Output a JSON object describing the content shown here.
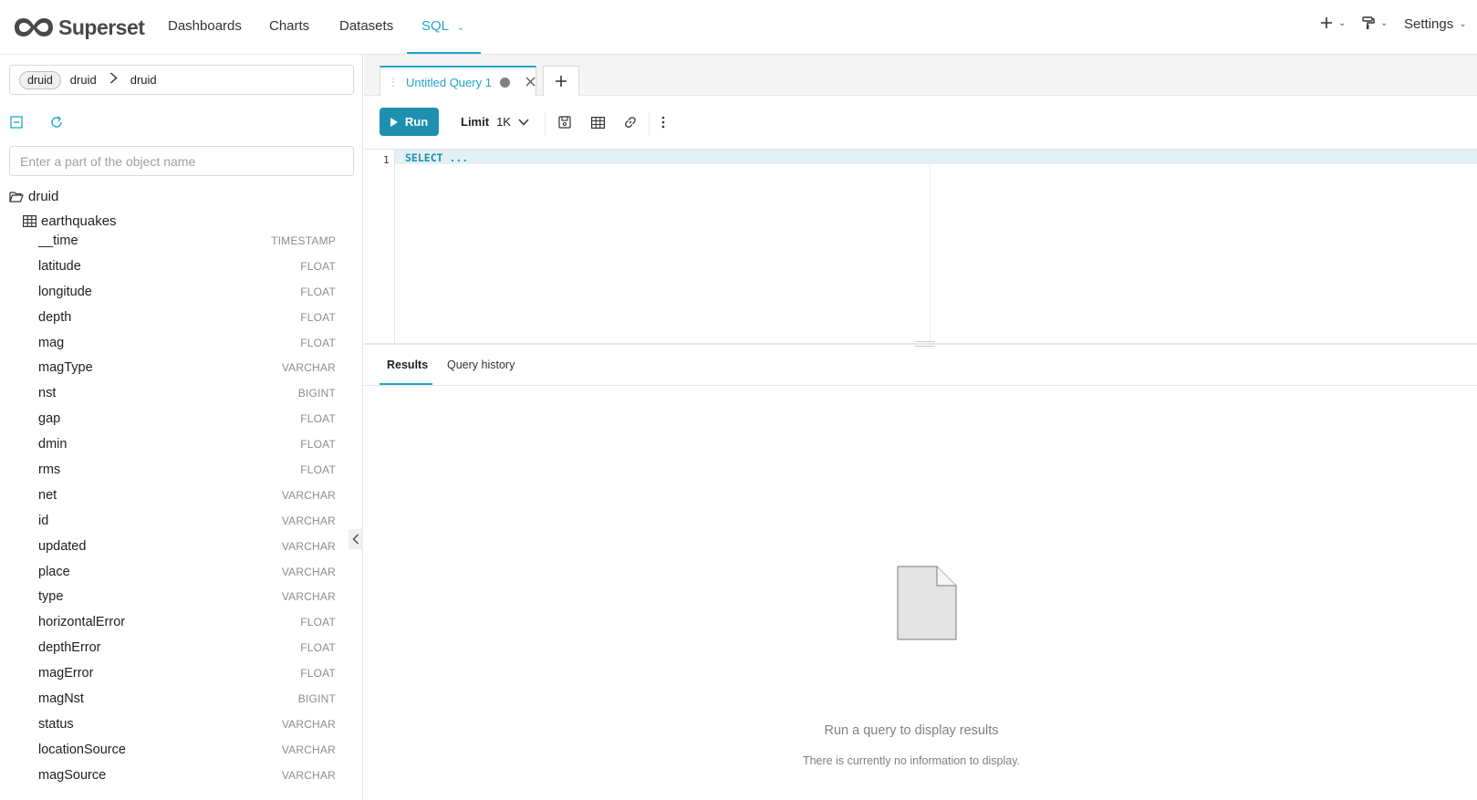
{
  "brand": {
    "name": "Superset"
  },
  "nav": {
    "items": [
      {
        "label": "Dashboards"
      },
      {
        "label": "Charts"
      },
      {
        "label": "Datasets"
      },
      {
        "label": "SQL"
      }
    ],
    "active": "SQL",
    "plus_icon": "plus-icon",
    "theme_icon": "paint-roller-icon",
    "settings_label": "Settings"
  },
  "left_panel": {
    "database_tag": "druid",
    "database_name": "druid",
    "schema": "druid",
    "search_placeholder": "Enter a part of the object name",
    "tree_root": "druid",
    "table_name": "earthquakes",
    "columns": [
      {
        "name": "__time",
        "type": "TIMESTAMP"
      },
      {
        "name": "latitude",
        "type": "FLOAT"
      },
      {
        "name": "longitude",
        "type": "FLOAT"
      },
      {
        "name": "depth",
        "type": "FLOAT"
      },
      {
        "name": "mag",
        "type": "FLOAT"
      },
      {
        "name": "magType",
        "type": "VARCHAR"
      },
      {
        "name": "nst",
        "type": "BIGINT"
      },
      {
        "name": "gap",
        "type": "FLOAT"
      },
      {
        "name": "dmin",
        "type": "FLOAT"
      },
      {
        "name": "rms",
        "type": "FLOAT"
      },
      {
        "name": "net",
        "type": "VARCHAR"
      },
      {
        "name": "id",
        "type": "VARCHAR"
      },
      {
        "name": "updated",
        "type": "VARCHAR"
      },
      {
        "name": "place",
        "type": "VARCHAR"
      },
      {
        "name": "type",
        "type": "VARCHAR"
      },
      {
        "name": "horizontalError",
        "type": "FLOAT"
      },
      {
        "name": "depthError",
        "type": "FLOAT"
      },
      {
        "name": "magError",
        "type": "FLOAT"
      },
      {
        "name": "magNst",
        "type": "BIGINT"
      },
      {
        "name": "status",
        "type": "VARCHAR"
      },
      {
        "name": "locationSource",
        "type": "VARCHAR"
      },
      {
        "name": "magSource",
        "type": "VARCHAR"
      }
    ]
  },
  "editor": {
    "tab_title": "Untitled Query 1",
    "run_label": "Run",
    "limit_label": "Limit",
    "limit_value": "1K",
    "line_number": "1",
    "code": "SELECT ..."
  },
  "results": {
    "tabs": [
      "Results",
      "Query history"
    ],
    "empty_title": "Run a query to display results",
    "empty_subtitle": "There is currently no information to display."
  },
  "colors": {
    "accent": "#20a7c9",
    "run_button": "#1e8faf"
  }
}
